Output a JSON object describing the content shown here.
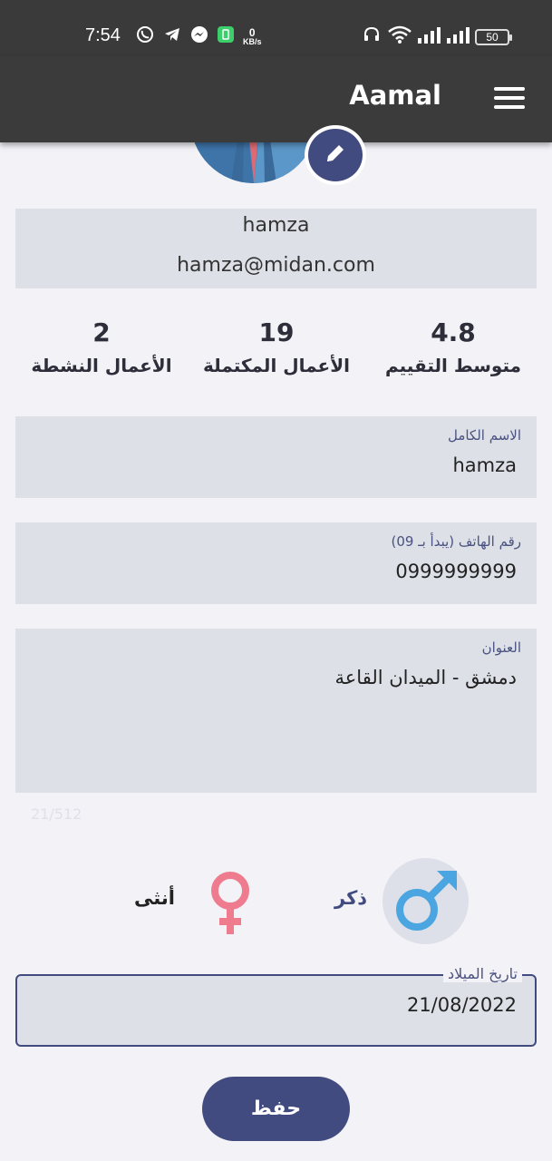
{
  "status_bar": {
    "time": "7:54",
    "network_speed_value": "0",
    "network_speed_unit": "KB/s",
    "battery": "50"
  },
  "app_bar": {
    "title": "Aamal"
  },
  "profile": {
    "name": "hamza",
    "email": "hamza@midan.com"
  },
  "stats": {
    "rating_value": "4.8",
    "rating_label": "متوسط التقييم",
    "completed_value": "19",
    "completed_label": "الأعمال المكتملة",
    "active_value": "2",
    "active_label": "الأعمال النشطة"
  },
  "form": {
    "full_name_label": "الاسم الكامل",
    "full_name_value": "hamza",
    "phone_label": "رقم الهاتف (يبدأ بـ 09)",
    "phone_value": "0999999999",
    "address_label": "العنوان",
    "address_value": "دمشق - الميدان القاعة",
    "address_counter": "21/512",
    "gender_male": "ذكر",
    "gender_female": "أنثى",
    "birth_date_label": "تاريخ الميلاد",
    "birth_date_value": "21/08/2022",
    "save_label": "حفظ"
  },
  "colors": {
    "accent": "#414b80",
    "field_bg": "#dde0e7",
    "page_bg": "#f2f2f7",
    "app_bar": "#3b3b3b",
    "female": "#ee7c8e",
    "male": "#4aa5e0"
  }
}
